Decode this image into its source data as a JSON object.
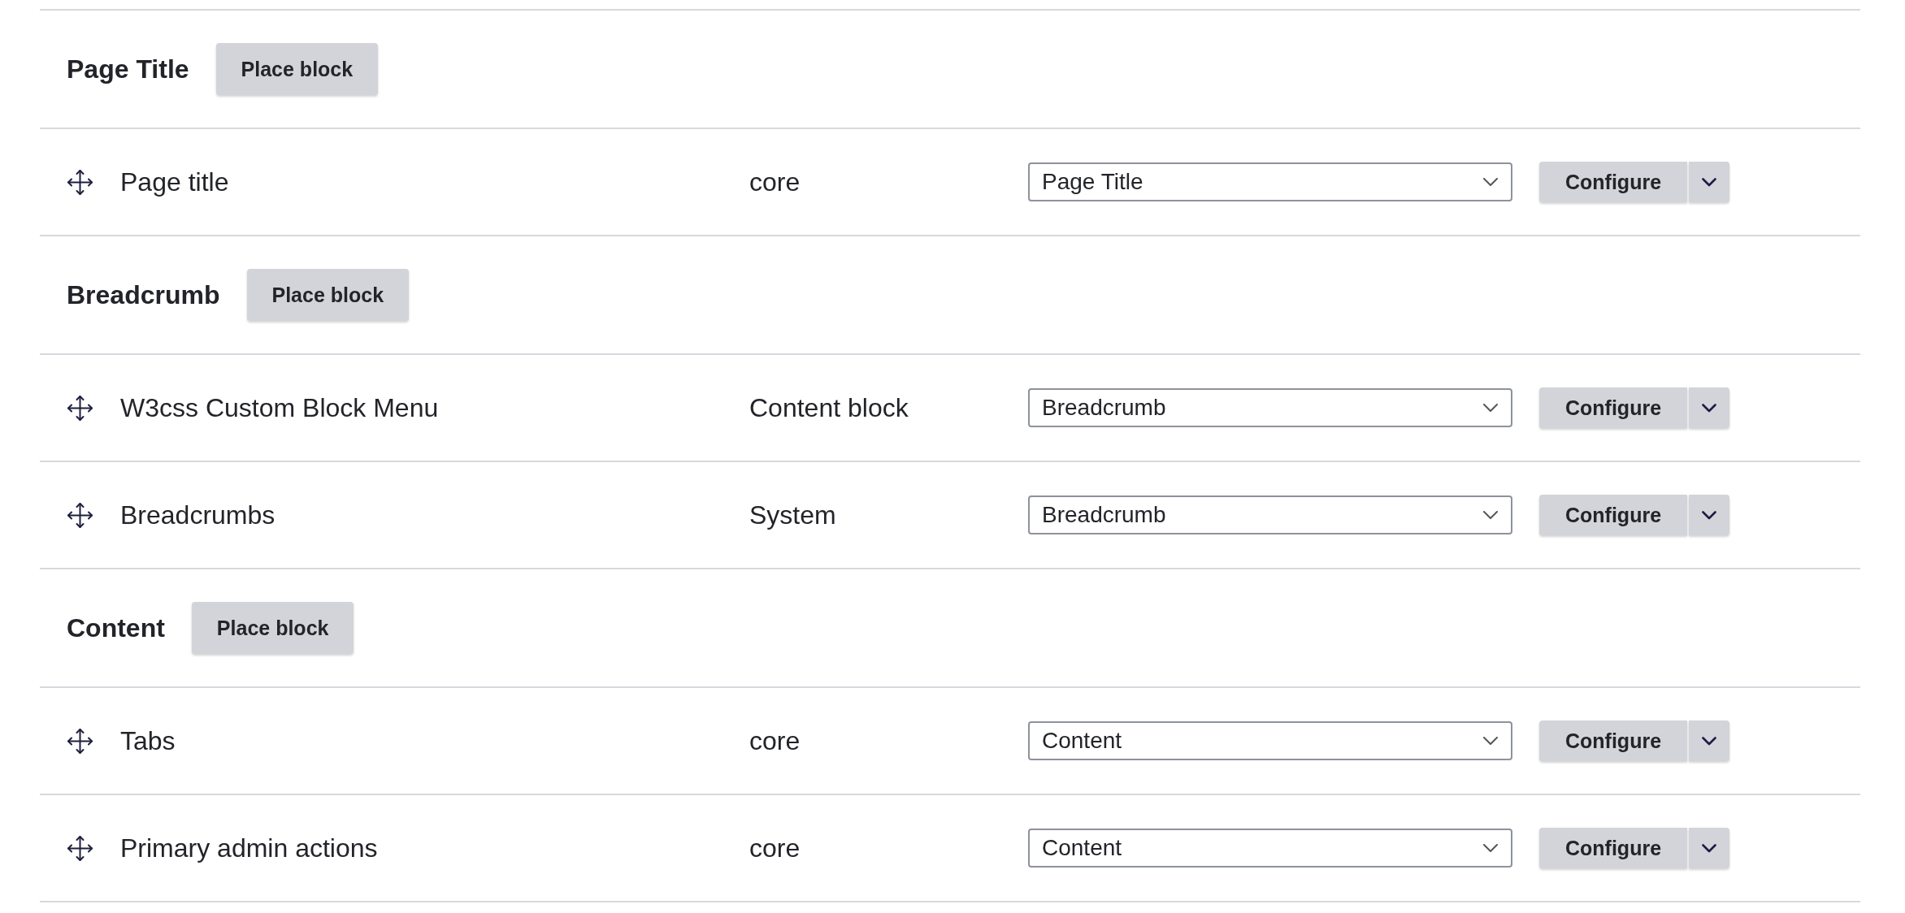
{
  "regions": [
    {
      "title": "Page Title",
      "button": "Place block",
      "blocks": [
        {
          "name": "Page title",
          "category": "core",
          "region": "Page Title",
          "action": "Configure"
        }
      ]
    },
    {
      "title": "Breadcrumb",
      "button": "Place block",
      "blocks": [
        {
          "name": "W3css Custom Block Menu",
          "category": "Content block",
          "region": "Breadcrumb",
          "action": "Configure"
        },
        {
          "name": "Breadcrumbs",
          "category": "System",
          "region": "Breadcrumb",
          "action": "Configure"
        }
      ]
    },
    {
      "title": "Content",
      "button": "Place block",
      "blocks": [
        {
          "name": "Tabs",
          "category": "core",
          "region": "Content",
          "action": "Configure"
        },
        {
          "name": "Primary admin actions",
          "category": "core",
          "region": "Content",
          "action": "Configure"
        }
      ]
    }
  ]
}
